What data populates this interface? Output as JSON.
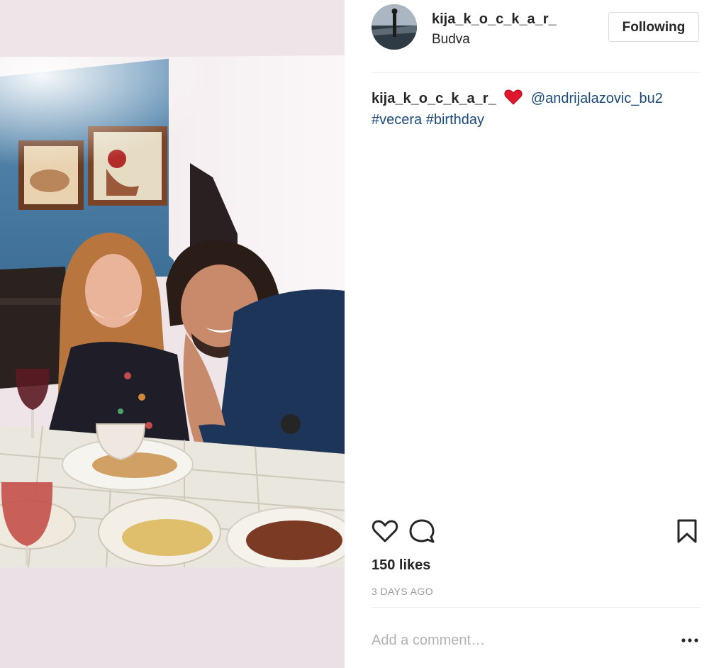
{
  "post": {
    "username": "kija_k_o_c_k_a_r_",
    "location": "Budva",
    "follow_label": "Following",
    "caption": {
      "username": "kija_k_o_c_k_a_r_",
      "heart_icon": "red-heart-emoji",
      "mention": "@andrijalazovic_bu2",
      "hashtags": [
        "#vecera",
        "#birthday"
      ]
    },
    "likes": "150 likes",
    "timestamp": "3 DAYS AGO",
    "comment_placeholder": "Add a comment…"
  },
  "icons": {
    "like": "heart-outline-icon",
    "comment": "comment-bubble-icon",
    "save": "bookmark-icon",
    "more": "more-options-icon"
  },
  "colors": {
    "text": "#262626",
    "link": "#1a4a7a",
    "muted": "#999999",
    "border": "#dbdbdb",
    "heart": "#e0182d"
  }
}
